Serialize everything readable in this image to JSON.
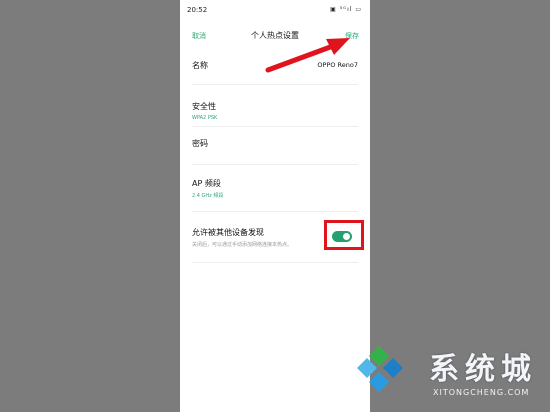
{
  "status_bar": {
    "time": "20:52",
    "icons_text": "▣ ⁵ᴳıl ▭"
  },
  "nav": {
    "cancel": "取消",
    "title": "个人热点设置",
    "save": "保存"
  },
  "rows": {
    "name": {
      "label": "名称",
      "value": "OPPO Reno7"
    },
    "security": {
      "label": "安全性",
      "sub": "WPA2 PSK"
    },
    "password": {
      "label": "密码"
    },
    "ap_band": {
      "label": "AP 频段",
      "sub": "2.4 GHz 频段"
    },
    "discoverable": {
      "label": "允许被其他设备发现",
      "desc": "关闭后，可以通过手动添加网络连接本热点。",
      "enabled": true
    }
  },
  "watermark": {
    "text": "系统城",
    "sub": "XITONGCHENG.COM"
  },
  "colors": {
    "accent": "#2aa876",
    "annotation_red": "#e0141c"
  }
}
